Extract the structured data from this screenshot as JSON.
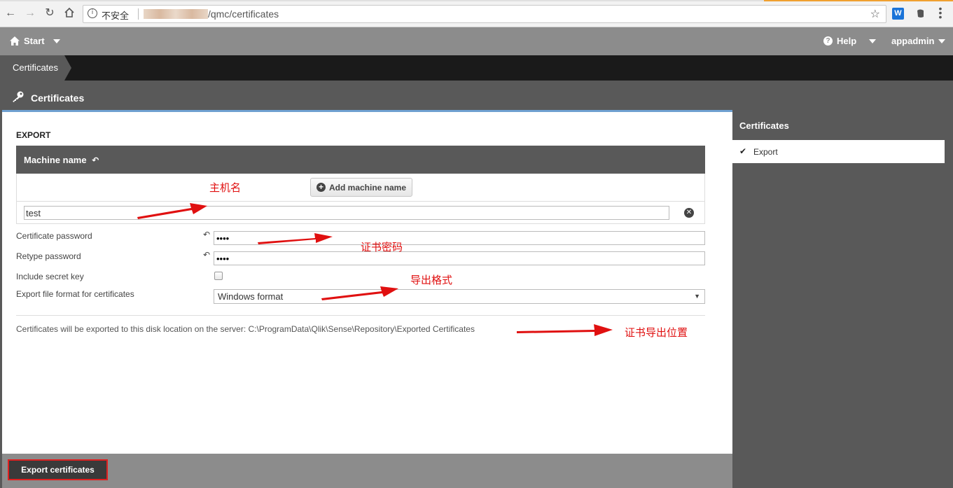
{
  "browser": {
    "security_label": "不安全",
    "url_path": "/qmc/certificates"
  },
  "header": {
    "start_label": "Start",
    "help_label": "Help",
    "user_label": "appadmin"
  },
  "breadcrumb": {
    "label": "Certificates"
  },
  "section": {
    "title": "Certificates"
  },
  "form": {
    "export_heading": "EXPORT",
    "machine_name_header": "Machine name",
    "add_machine_label": "Add machine name",
    "machine_name_value": "test",
    "cert_password_label": "Certificate password",
    "cert_password_value": "••••",
    "retype_password_label": "Retype password",
    "retype_password_value": "••••",
    "include_secret_key_label": "Include secret key",
    "include_secret_key_checked": false,
    "format_label": "Export file format for certificates",
    "format_value": "Windows format",
    "location_text": "Certificates will be exported to this disk location on the server: C:\\ProgramData\\Qlik\\Sense\\Repository\\Exported Certificates"
  },
  "annotations": {
    "machine_name": "主机名",
    "cert_password": "证书密码",
    "export_format": "导出格式",
    "export_location": "证书导出位置",
    "color": "#e01010"
  },
  "right_panel": {
    "title": "Certificates",
    "items": [
      {
        "label": "Export",
        "selected": true
      }
    ]
  },
  "footer": {
    "export_button_label": "Export certificates"
  },
  "colors": {
    "header_gray": "#8c8c8c",
    "dark_gray": "#595959",
    "breadcrumb_black": "#1a1a1a",
    "accent_blue": "#6fa0d0",
    "highlight_red": "#e02020"
  }
}
